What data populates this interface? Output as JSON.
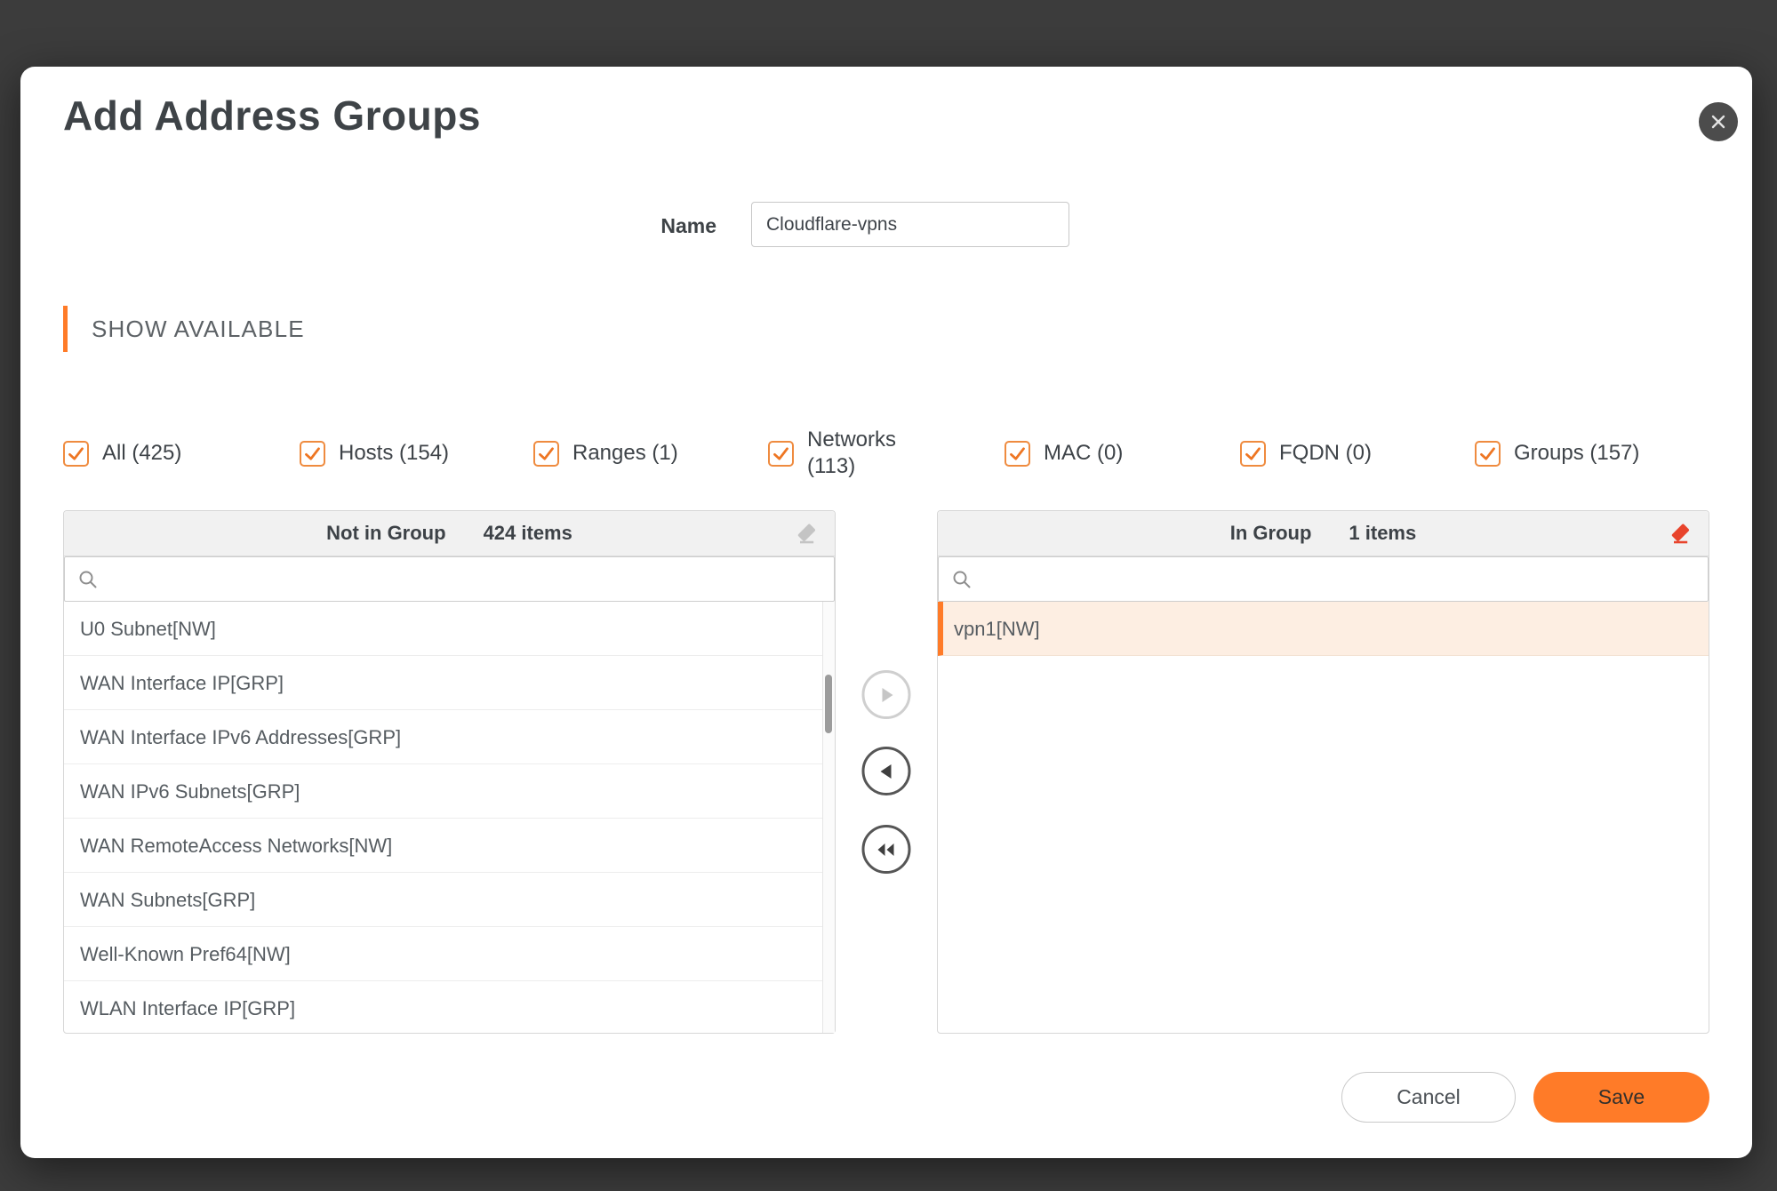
{
  "dialog": {
    "title": "Add Address Groups"
  },
  "form": {
    "name_label": "Name",
    "name_value": "Cloudflare-vpns"
  },
  "section": {
    "header": "SHOW AVAILABLE"
  },
  "filters": [
    {
      "label": "All (425)",
      "checked": true
    },
    {
      "label": "Hosts (154)",
      "checked": true
    },
    {
      "label": "Ranges (1)",
      "checked": true
    },
    {
      "label": "Networks (113)",
      "checked": true
    },
    {
      "label": "MAC (0)",
      "checked": true
    },
    {
      "label": "FQDN (0)",
      "checked": true
    },
    {
      "label": "Groups (157)",
      "checked": true
    }
  ],
  "left_panel": {
    "title": "Not in Group",
    "count": "424 items",
    "search_value": "",
    "items": [
      "U0 Subnet[NW]",
      "WAN Interface IP[GRP]",
      "WAN Interface IPv6 Addresses[GRP]",
      "WAN IPv6 Subnets[GRP]",
      "WAN RemoteAccess Networks[NW]",
      "WAN Subnets[GRP]",
      "Well-Known Pref64[NW]",
      "WLAN Interface IP[GRP]"
    ]
  },
  "right_panel": {
    "title": "In Group",
    "count": "1 items",
    "search_value": "",
    "items": [
      "vpn1[NW]"
    ],
    "selected_index": 0
  },
  "actions": {
    "cancel": "Cancel",
    "save": "Save"
  },
  "icons": {
    "close": "×",
    "search": "magnifier",
    "checkbox_check": "✓",
    "clear_list": "eraser",
    "move_right": "▶",
    "move_left": "◀",
    "move_all_left": "◀◀",
    "scrollbar": "vertical-thumb"
  },
  "colors": {
    "accent_orange": "#ff7b28",
    "checkbox_border": "#ef8b3f",
    "selected_row_bg": "#fdeee2",
    "clear_icon_red": "#e8442c",
    "page_bg": "#3c3c3c",
    "dialog_bg": "#ffffff"
  }
}
